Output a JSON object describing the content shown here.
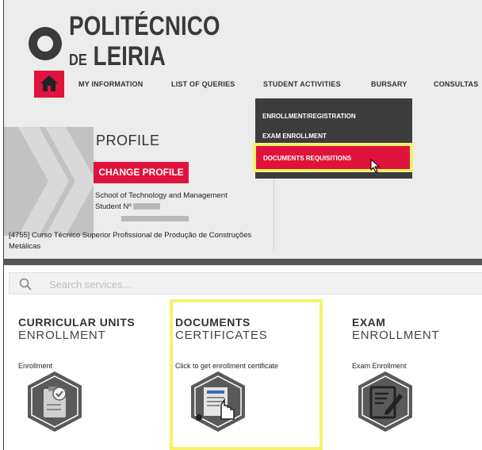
{
  "logo": {
    "line1": "POLITÉCNICO",
    "line2_small": "DE",
    "line2": "LEIRIA"
  },
  "nav": {
    "home_icon": "home-icon",
    "items": [
      "MY INFORMATION",
      "LIST OF QUERIES",
      "STUDENT ACTIVITIES",
      "BURSARY",
      "CONSULTAS"
    ]
  },
  "dropdown": {
    "items": [
      "ENROLLMENT/REGISTRATION",
      "EXAM ENROLLMENT",
      "DOCUMENTS REQUISITIONS"
    ]
  },
  "profile": {
    "title": "PROFILE",
    "change_button": "CHANGE PROFILE",
    "school": "School of Technology and Management",
    "student_label": "Student Nº",
    "course": "[4755] Curso Técnico Superior Profissional de Produção de Construções Metálicas"
  },
  "search": {
    "placeholder": "Search services..."
  },
  "cards": [
    {
      "title1": "CURRICULAR UNITS",
      "title2": "ENROLLMENT",
      "link": "Enrollment",
      "icon": "clipboard-check-icon"
    },
    {
      "title1": "DOCUMENTS",
      "title2": "CERTIFICATES",
      "link": "Click to get enrollment certificate",
      "icon": "document-hand-icon"
    },
    {
      "title1": "EXAM",
      "title2": "ENROLLMENT",
      "link": "Exam Enrollment",
      "icon": "edit-document-icon"
    }
  ],
  "colors": {
    "accent": "#e0133c",
    "highlight": "#f7f16a",
    "dark": "#3d3d3d",
    "hex_icon": "#5a5a5a"
  }
}
